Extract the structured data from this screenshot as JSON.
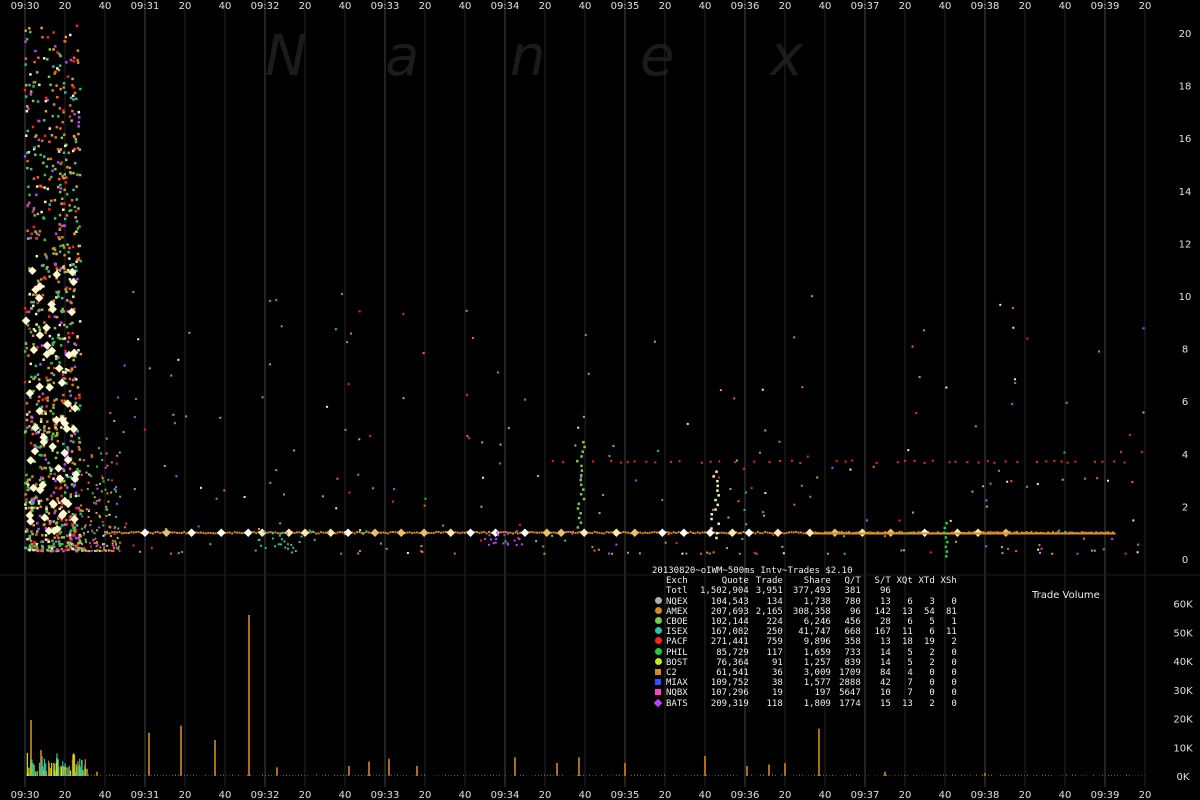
{
  "watermark": [
    "N",
    "a",
    "n",
    "e",
    "x"
  ],
  "chart_data": [
    {
      "type": "scatter",
      "title": "20130820~oIWM~500ms Intv~Trades $2.10",
      "x_tick_labels": [
        "09:30",
        "20",
        "40",
        "09:31",
        "20",
        "40",
        "09:32",
        "20",
        "40",
        "09:33",
        "20",
        "40",
        "09:34",
        "20",
        "40",
        "09:35",
        "20",
        "40",
        "09:36",
        "20",
        "40",
        "09:37",
        "20",
        "40",
        "09:38",
        "20",
        "40",
        "09:39",
        "20"
      ],
      "x_range_seconds": [
        0,
        580
      ],
      "ylim": [
        0,
        21
      ],
      "y_ticks": [
        0,
        2,
        4,
        6,
        8,
        10,
        12,
        14,
        16,
        18,
        20
      ],
      "grid": true,
      "series": [
        {
          "name": "AMEX",
          "color": "#d88a1a",
          "baseline_value": 1.0
        }
      ]
    },
    {
      "type": "bar",
      "title": "Trade Volume",
      "ylim": [
        0,
        60000
      ],
      "y_tick_labels": [
        "0K",
        "10K",
        "20K",
        "30K",
        "40K",
        "50K",
        "60K"
      ],
      "y_ticks": [
        0,
        10000,
        20000,
        30000,
        40000,
        50000,
        60000
      ],
      "bars": [
        {
          "t": 3,
          "v": 19500
        },
        {
          "t": 8,
          "v": 9000
        },
        {
          "t": 12,
          "v": 4500
        },
        {
          "t": 18,
          "v": 3500
        },
        {
          "t": 24,
          "v": 7500
        },
        {
          "t": 31,
          "v": 2500
        },
        {
          "t": 36,
          "v": 1500
        },
        {
          "t": 62,
          "v": 15000
        },
        {
          "t": 78,
          "v": 17500
        },
        {
          "t": 95,
          "v": 12500
        },
        {
          "t": 112,
          "v": 56000
        },
        {
          "t": 126,
          "v": 3000
        },
        {
          "t": 162,
          "v": 3500
        },
        {
          "t": 172,
          "v": 5000
        },
        {
          "t": 182,
          "v": 6000
        },
        {
          "t": 196,
          "v": 3500
        },
        {
          "t": 245,
          "v": 6500
        },
        {
          "t": 266,
          "v": 4500
        },
        {
          "t": 277,
          "v": 6500
        },
        {
          "t": 300,
          "v": 4500
        },
        {
          "t": 340,
          "v": 7000
        },
        {
          "t": 361,
          "v": 3500
        },
        {
          "t": 372,
          "v": 4000
        },
        {
          "t": 380,
          "v": 4500
        },
        {
          "t": 397,
          "v": 16500
        },
        {
          "t": 430,
          "v": 1500
        },
        {
          "t": 480,
          "v": 1000
        }
      ]
    }
  ],
  "stats": {
    "title": "20130820~oIWM~500ms Intv~Trades $2.10",
    "headers": [
      "Exch",
      "Quote",
      "Trade",
      "Share",
      "Q/T",
      "S/T",
      "XQt",
      "XTd",
      "XSh"
    ],
    "total": {
      "label": "Totl",
      "values": [
        "1,502,904",
        "3,951",
        "377,493",
        "381",
        "96",
        "",
        "",
        ""
      ]
    },
    "rows": [
      {
        "label": "NQEX",
        "marker": "dot",
        "color": "#b0b0b0",
        "values": [
          "104,543",
          "134",
          "1,738",
          "780",
          "13",
          "6",
          "3",
          "0"
        ]
      },
      {
        "label": "AMEX",
        "marker": "dot",
        "color": "#d88a1a",
        "values": [
          "207,693",
          "2,165",
          "308,358",
          "96",
          "142",
          "13",
          "54",
          "81"
        ]
      },
      {
        "label": "CBOE",
        "marker": "dot",
        "color": "#7ec84a",
        "values": [
          "102,144",
          "224",
          "6,246",
          "456",
          "28",
          "6",
          "5",
          "1"
        ]
      },
      {
        "label": "ISEX",
        "marker": "dot",
        "color": "#2fc1a6",
        "values": [
          "167,082",
          "250",
          "41,747",
          "668",
          "167",
          "11",
          "6",
          "11"
        ]
      },
      {
        "label": "PACF",
        "marker": "dot",
        "color": "#ff2020",
        "values": [
          "271,441",
          "759",
          "9,896",
          "358",
          "13",
          "18",
          "19",
          "2"
        ]
      },
      {
        "label": "PHIL",
        "marker": "dot",
        "color": "#22cc44",
        "values": [
          "85,729",
          "117",
          "1,659",
          "733",
          "14",
          "5",
          "2",
          "0"
        ]
      },
      {
        "label": "BOST",
        "marker": "dot",
        "color": "#c8e62a",
        "values": [
          "76,364",
          "91",
          "1,257",
          "839",
          "14",
          "5",
          "2",
          "0"
        ]
      },
      {
        "label": "C2",
        "marker": "sq",
        "color": "#d88a1a",
        "values": [
          "61,541",
          "36",
          "3,009",
          "1709",
          "84",
          "4",
          "0",
          "0"
        ]
      },
      {
        "label": "MIAX",
        "marker": "sq",
        "color": "#3050ff",
        "values": [
          "109,752",
          "38",
          "1,577",
          "2888",
          "42",
          "7",
          "0",
          "0"
        ]
      },
      {
        "label": "NQBX",
        "marker": "sq",
        "color": "#ff40c0",
        "values": [
          "107,296",
          "19",
          "197",
          "5647",
          "10",
          "7",
          "0",
          "0"
        ]
      },
      {
        "label": "BATS",
        "marker": "dia",
        "color": "#c040ff",
        "values": [
          "209,319",
          "118",
          "1,809",
          "1774",
          "15",
          "13",
          "2",
          "0"
        ]
      }
    ]
  },
  "volume_label": "Trade Volume"
}
